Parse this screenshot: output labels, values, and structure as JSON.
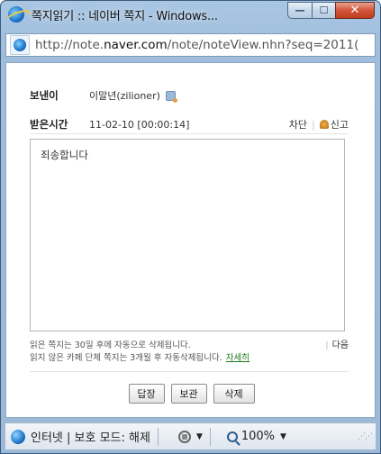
{
  "window": {
    "title": "쪽지읽기 :: 네이버 쪽지 - Windows...",
    "minimize_label": "—",
    "maximize_label": "☐",
    "close_label": "✕"
  },
  "address_bar": {
    "prefix": "http://note.",
    "host": "naver.com",
    "path": "/note/noteView.nhn?seq=2011("
  },
  "note": {
    "sender_label": "보낸이",
    "sender_value": "이말년(zilioner)",
    "time_label": "받은시간",
    "time_value": "11-02-10 [00:00:14]",
    "block_label": "차단",
    "report_label": "신고",
    "message": "죄송합니다"
  },
  "notice": {
    "line1": "읽은 쪽지는 30일 후에 자동으로 삭제됩니다.",
    "line2": "읽지 않은 카페 단체 쪽지는 3개월 후 자동삭제됩니다.",
    "detail_link": "자세히",
    "next_label": "다음"
  },
  "buttons": {
    "reply": "답장",
    "save": "보관",
    "delete": "삭제"
  },
  "status_bar": {
    "zone": "인터넷 | 보호 모드: 해제",
    "zoom": "100%"
  }
}
